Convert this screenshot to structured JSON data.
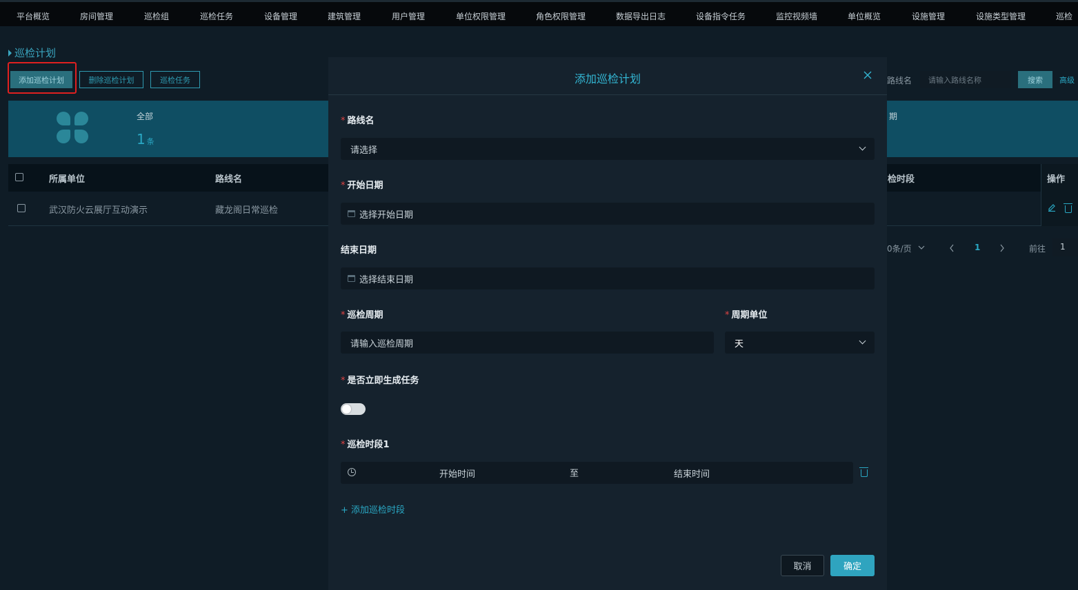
{
  "nav": {
    "items": [
      "平台概览",
      "房间管理",
      "巡检组",
      "巡检任务",
      "设备管理",
      "建筑管理",
      "用户管理",
      "单位权限管理",
      "角色权限管理",
      "数据导出日志",
      "设备指令任务",
      "监控视频墙",
      "单位概览",
      "设施管理",
      "设施类型管理",
      "巡检"
    ]
  },
  "page": {
    "title": "巡检计划",
    "buttons": {
      "add": "添加巡检计划",
      "delete": "删除巡检计划",
      "tasks": "巡检任务"
    },
    "stat": {
      "label": "全部",
      "value": "1",
      "unit": "条"
    },
    "search": {
      "label": "路线名",
      "placeholder": "请输入路线名称",
      "button": "搜索",
      "advanced": "高级"
    },
    "partial_stat_label": "期",
    "table": {
      "headers": {
        "unit": "所属单位",
        "route": "路线名",
        "period": "检时段",
        "ops": "操作"
      },
      "rows": [
        {
          "unit": "武汉防火云展厅互动演示",
          "route": "藏龙阁日常巡检"
        }
      ]
    },
    "pager": {
      "page_size": "0条/页",
      "current": "1",
      "goto_label": "前往",
      "goto_value": "1"
    }
  },
  "modal": {
    "title": "添加巡检计划",
    "close_icon": "close-icon",
    "fields": {
      "route": {
        "label": "路线名",
        "placeholder": "请选择"
      },
      "start_date": {
        "label": "开始日期",
        "placeholder": "选择开始日期"
      },
      "end_date": {
        "label": "结束日期",
        "placeholder": "选择结束日期"
      },
      "cycle": {
        "label": "巡检周期",
        "placeholder": "请输入巡检周期"
      },
      "cycle_unit": {
        "label": "周期单位",
        "value": "天"
      },
      "generate_now": {
        "label": "是否立即生成任务",
        "enabled": false
      },
      "period1": {
        "label": "巡检时段1",
        "start_placeholder": "开始时间",
        "separator": "至",
        "end_placeholder": "结束时间"
      }
    },
    "add_period": "+ 添加巡检时段",
    "cancel": "取消",
    "confirm": "确定"
  },
  "colors": {
    "accent": "#2fa4bf",
    "highlight": "#e02020",
    "required": "#e04444"
  }
}
